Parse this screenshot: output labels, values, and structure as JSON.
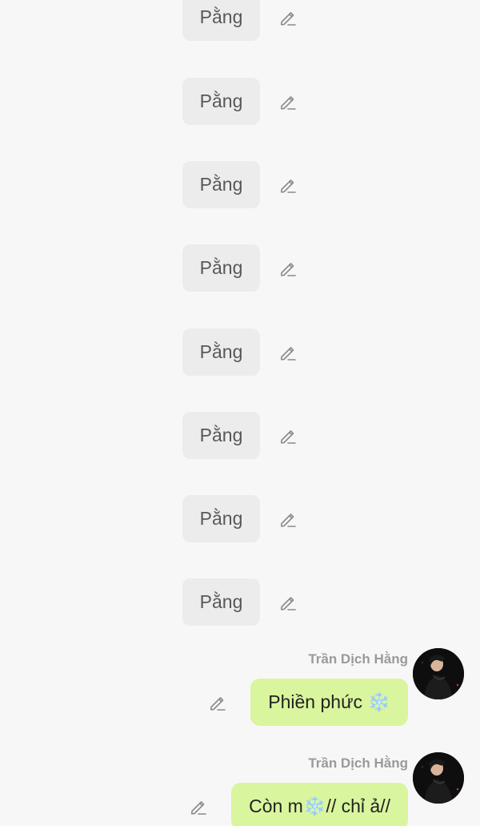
{
  "system_messages": [
    {
      "text": "Pằng"
    },
    {
      "text": "Pằng"
    },
    {
      "text": "Pằng"
    },
    {
      "text": "Pằng"
    },
    {
      "text": "Pằng"
    },
    {
      "text": "Pằng"
    },
    {
      "text": "Pằng"
    },
    {
      "text": "Pằng"
    }
  ],
  "user_messages": [
    {
      "sender": "Trần Dịch Hằng",
      "text": "Phiền phức ❄️"
    },
    {
      "sender": "Trần Dịch Hằng",
      "text": "Còn m❄️// chỉ ả//"
    }
  ],
  "icons": {
    "edit": "pencil-icon",
    "snowflake": "❄️"
  },
  "colors": {
    "background": "#f7f7f8",
    "system_bubble": "#ececec",
    "user_bubble": "#d9f59e",
    "sender_name": "#9a9a9a"
  }
}
